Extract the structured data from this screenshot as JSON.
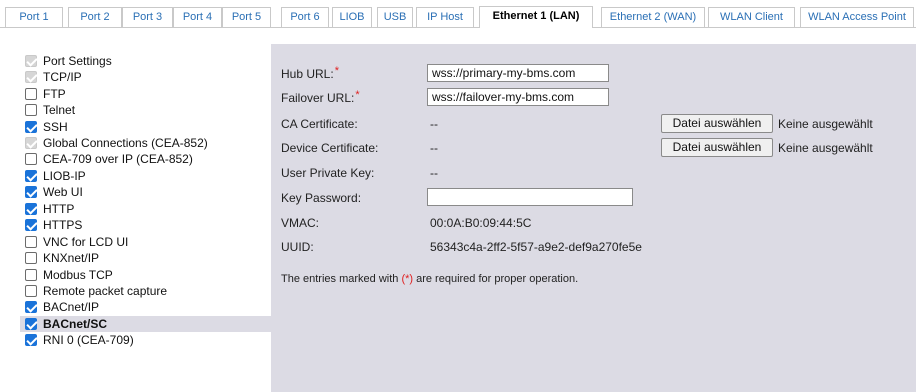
{
  "tabs": [
    {
      "label": "Port 1"
    },
    {
      "label": "Port 2"
    },
    {
      "label": "Port 3"
    },
    {
      "label": "Port 4"
    },
    {
      "label": "Port 5"
    },
    {
      "label": "Port 6"
    },
    {
      "label": "LIOB"
    },
    {
      "label": "USB"
    },
    {
      "label": "IP Host"
    },
    {
      "label": "Ethernet 1 (LAN)",
      "active": true
    },
    {
      "label": "Ethernet 2 (WAN)"
    },
    {
      "label": "WLAN Client"
    },
    {
      "label": "WLAN Access Point"
    }
  ],
  "tree": {
    "items": [
      {
        "label": "Port Settings",
        "state": "disabled"
      },
      {
        "label": "TCP/IP",
        "state": "disabled"
      },
      {
        "label": "FTP",
        "state": "unchecked"
      },
      {
        "label": "Telnet",
        "state": "unchecked"
      },
      {
        "label": "SSH",
        "state": "checked"
      },
      {
        "label": "Global Connections (CEA-852)",
        "state": "disabled"
      },
      {
        "label": "CEA-709 over IP (CEA-852)",
        "state": "unchecked"
      },
      {
        "label": "LIOB-IP",
        "state": "checked"
      },
      {
        "label": "Web UI",
        "state": "checked"
      },
      {
        "label": "HTTP",
        "state": "checked"
      },
      {
        "label": "HTTPS",
        "state": "checked"
      },
      {
        "label": "VNC for LCD UI",
        "state": "unchecked"
      },
      {
        "label": "KNXnet/IP",
        "state": "unchecked"
      },
      {
        "label": "Modbus TCP",
        "state": "unchecked"
      },
      {
        "label": "Remote packet capture",
        "state": "unchecked"
      },
      {
        "label": "BACnet/IP",
        "state": "checked"
      },
      {
        "label": "BACnet/SC",
        "state": "checked",
        "selected": true
      },
      {
        "label": "RNI 0 (CEA-709)",
        "state": "checked"
      }
    ]
  },
  "form": {
    "required_mark": "*",
    "hub_url": {
      "label": "Hub URL:",
      "value": "wss://primary-my-bms.com"
    },
    "failover_url": {
      "label": "Failover URL:",
      "value": "wss://failover-my-bms.com"
    },
    "ca_certificate": {
      "label": "CA Certificate:",
      "value": "--",
      "button": "Datei auswählen",
      "file_state": "Keine ausgewählt"
    },
    "device_certificate": {
      "label": "Device Certificate:",
      "value": "--",
      "button": "Datei auswählen",
      "file_state": "Keine ausgewählt"
    },
    "user_private_key": {
      "label": "User Private Key:",
      "value": "--"
    },
    "key_password": {
      "label": "Key Password:",
      "value": ""
    },
    "vmac": {
      "label": "VMAC:",
      "value": "00:0A:B0:09:44:5C"
    },
    "uuid": {
      "label": "UUID:",
      "value": "56343c4a-2ff2-5f57-a9e2-def9a270fe5e"
    },
    "note": {
      "before": "The entries marked with ",
      "marker": "(*)",
      "after": " are required for proper operation."
    }
  },
  "colors": {
    "accent_checkbox": "#1a73d9",
    "tab_link": "#2a6fb5",
    "panel_bg": "#dcdbe4",
    "required": "#e02020"
  }
}
